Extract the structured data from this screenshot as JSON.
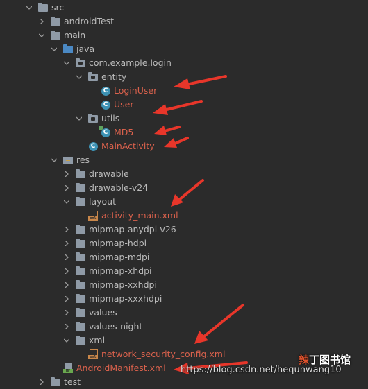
{
  "tree": [
    {
      "label": "src",
      "icon": "folder",
      "arrow": "down",
      "red": false
    },
    {
      "label": "androidTest",
      "icon": "folder",
      "arrow": "right",
      "red": false
    },
    {
      "label": "main",
      "icon": "folder",
      "arrow": "down",
      "red": false
    },
    {
      "label": "java",
      "icon": "folder-blue",
      "arrow": "down",
      "red": false
    },
    {
      "label": "com.example.login",
      "icon": "package",
      "arrow": "down",
      "red": false
    },
    {
      "label": "entity",
      "icon": "package",
      "arrow": "down",
      "red": false
    },
    {
      "label": "LoginUser",
      "icon": "class",
      "arrow": "none",
      "red": true
    },
    {
      "label": "User",
      "icon": "class",
      "arrow": "none",
      "red": true
    },
    {
      "label": "utils",
      "icon": "package",
      "arrow": "down",
      "red": false
    },
    {
      "label": "MD5",
      "icon": "class-sub",
      "arrow": "none",
      "red": true
    },
    {
      "label": "MainActivity",
      "icon": "class",
      "arrow": "none",
      "red": true
    },
    {
      "label": "res",
      "icon": "res-folder",
      "arrow": "down",
      "red": false
    },
    {
      "label": "drawable",
      "icon": "folder",
      "arrow": "right",
      "red": false
    },
    {
      "label": "drawable-v24",
      "icon": "folder",
      "arrow": "right",
      "red": false
    },
    {
      "label": "layout",
      "icon": "folder",
      "arrow": "down",
      "red": false
    },
    {
      "label": "activity_main.xml",
      "icon": "xml",
      "arrow": "none",
      "red": true
    },
    {
      "label": "mipmap-anydpi-v26",
      "icon": "folder",
      "arrow": "right",
      "red": false
    },
    {
      "label": "mipmap-hdpi",
      "icon": "folder",
      "arrow": "right",
      "red": false
    },
    {
      "label": "mipmap-mdpi",
      "icon": "folder",
      "arrow": "right",
      "red": false
    },
    {
      "label": "mipmap-xhdpi",
      "icon": "folder",
      "arrow": "right",
      "red": false
    },
    {
      "label": "mipmap-xxhdpi",
      "icon": "folder",
      "arrow": "right",
      "red": false
    },
    {
      "label": "mipmap-xxxhdpi",
      "icon": "folder",
      "arrow": "right",
      "red": false
    },
    {
      "label": "values",
      "icon": "folder",
      "arrow": "right",
      "red": false
    },
    {
      "label": "values-night",
      "icon": "folder",
      "arrow": "right",
      "red": false
    },
    {
      "label": "xml",
      "icon": "folder",
      "arrow": "down",
      "red": false
    },
    {
      "label": "network_security_config.xml",
      "icon": "xml",
      "arrow": "none",
      "red": true
    },
    {
      "label": "AndroidManifest.xml",
      "icon": "manifest",
      "arrow": "none",
      "red": true
    },
    {
      "label": "test",
      "icon": "folder",
      "arrow": "right",
      "red": false
    }
  ],
  "icon_text": {
    "class": "C",
    "xml": "xml",
    "manifest": "MF"
  },
  "watermark": "https://blog.csdn.net/hequnwang10",
  "site_logo": {
    "accent": "辣",
    "rest": "丁图书馆"
  },
  "colors": {
    "background": "#2b2b2b",
    "text": "#bbbbbb",
    "modified_file": "#d9614c",
    "annotation_arrow": "#e8362a"
  }
}
